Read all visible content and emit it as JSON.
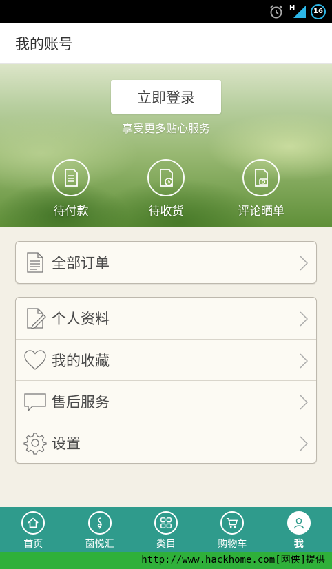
{
  "status_bar": {
    "network": "H",
    "battery": "16",
    "icons": [
      "alarm-icon",
      "signal-icon",
      "battery-icon"
    ]
  },
  "header": {
    "title": "我的账号"
  },
  "banner": {
    "login_button": "立即登录",
    "subtitle": "享受更多贴心服务",
    "shortcuts": [
      {
        "label": "待付款",
        "icon": "document-icon"
      },
      {
        "label": "待收货",
        "icon": "document-clock-icon"
      },
      {
        "label": "评论晒单",
        "icon": "document-camera-icon"
      }
    ]
  },
  "orders_menu": [
    {
      "label": "全部订单",
      "icon": "order-list-icon"
    }
  ],
  "account_menu": [
    {
      "label": "个人资料",
      "icon": "profile-edit-icon"
    },
    {
      "label": "我的收藏",
      "icon": "heart-icon"
    },
    {
      "label": "售后服务",
      "icon": "chat-bubble-icon"
    },
    {
      "label": "设置",
      "icon": "gear-icon"
    }
  ],
  "bottom_nav": {
    "items": [
      {
        "label": "首页",
        "icon": "home-icon"
      },
      {
        "label": "茵悦汇",
        "icon": "music-note-icon"
      },
      {
        "label": "类目",
        "icon": "grid-icon"
      },
      {
        "label": "购物车",
        "icon": "cart-icon"
      },
      {
        "label": "我",
        "icon": "person-icon"
      }
    ],
    "active": "我"
  },
  "footer": {
    "watermark": "http://www.hackhome.com[网侠]提供"
  },
  "colors": {
    "nav_bg": "#2f9b8c",
    "footer_bg": "#2fb03a",
    "page_bg": "#f3f0e6",
    "battery_ring": "#2db7e8"
  }
}
